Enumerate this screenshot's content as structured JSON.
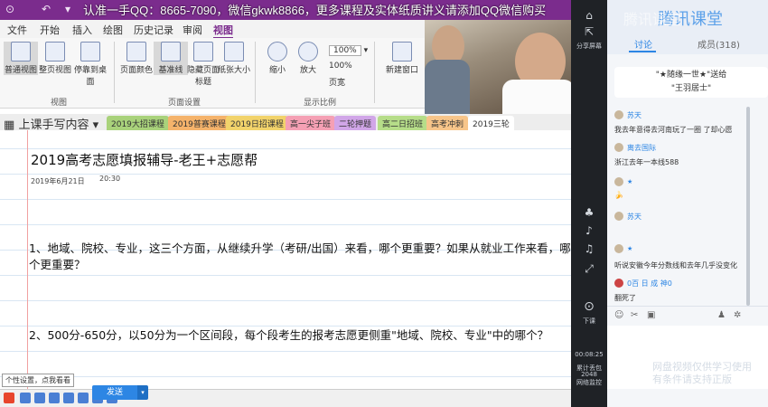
{
  "titlebar": {
    "banner": "认准一手QQ：8665-7090，微信gkwk8866，更多课程及实体纸质讲义请添加QQ微信购买"
  },
  "menu": {
    "tabs": [
      "文件",
      "开始",
      "插入",
      "绘图",
      "历史记录",
      "审阅",
      "视图"
    ],
    "active": "视图"
  },
  "ribbon": {
    "buttons": [
      "普通视图",
      "整页视图",
      "停靠到桌面",
      "页面颜色",
      "基准线",
      "隐藏页面标题",
      "纸张大小",
      "缩小",
      "放大",
      "新建窗口"
    ],
    "groups": [
      "视图",
      "页面设置",
      "显示比例"
    ],
    "zoom": [
      "100%",
      "100%",
      "页宽"
    ]
  },
  "notebook": {
    "name": "上课手写内容",
    "sections": [
      "2019大招课程",
      "2019普赛课程",
      "2019日招课程",
      "高一尖子班",
      "二轮押题",
      "高二日招班",
      "高考冲刺",
      "2019三轮"
    ]
  },
  "page": {
    "title": "2019高考志愿填报辅导-老王+志愿帮",
    "date": "2019年6月21日",
    "time": "20:30",
    "q1": "1、地域、院校、专业，这三个方面，从继续升学（考研/出国）来看，哪个更重要？如果从就业工作来看，哪个更重要？",
    "q2": "2、500分-650分，以50分为一个区间段，每个段考生的报考志愿更侧重\"地域、院校、专业\"中的哪个？",
    "tooltip": "个性设置，点我看看"
  },
  "tencent": {
    "brand": "腾讯课堂",
    "tabs": [
      "讨论",
      "成员(318)"
    ],
    "side": [
      "分享屏幕",
      "下课"
    ],
    "gift_line1": "\"★随缘一世★\"送给",
    "gift_line2": "\"王羽居士\"",
    "messages": [
      {
        "user": "苏天",
        "text": "我去年意得去河南玩了一圈 了却心愿"
      },
      {
        "user": "离去国际",
        "text": "浙江去年一本线588"
      },
      {
        "user": "苏天",
        "text": "听说安徽今年分数线和去年几乎没变化"
      },
      {
        "user": "0百 日 成 神0",
        "text": "翻死了"
      }
    ],
    "time": "00:08:25",
    "stats": [
      "累计丢包",
      "2048",
      "网络监控"
    ],
    "send": "发送",
    "watermark": [
      "网盘视频仅供学习使用",
      "有条件请支持正版"
    ]
  }
}
